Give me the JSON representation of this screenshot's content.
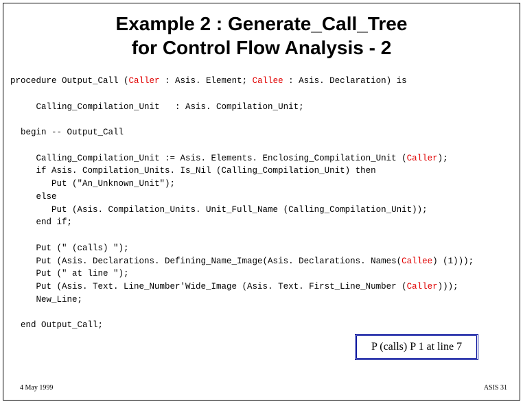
{
  "title_l1": "Example 2 : Generate_Call_Tree",
  "title_l2": "for Control Flow Analysis - 2",
  "code": {
    "l1a": "procedure Output_Call (",
    "l1b": "Caller",
    "l1c": " : Asis. Element; ",
    "l1d": "Callee",
    "l1e": " : Asis. Declaration) is",
    "l2": "     Calling_Compilation_Unit   : Asis. Compilation_Unit;",
    "l3": "  begin -- Output_Call",
    "l4a": "     Calling_Compilation_Unit := Asis. Elements. Enclosing_Compilation_Unit (",
    "l4b": "Caller",
    "l4c": ");",
    "l5": "     if Asis. Compilation_Units. Is_Nil (Calling_Compilation_Unit) then",
    "l6": "        Put (\"An_Unknown_Unit\");",
    "l7": "     else",
    "l8": "        Put (Asis. Compilation_Units. Unit_Full_Name (Calling_Compilation_Unit));",
    "l9": "     end if;",
    "l10": "     Put (\" (calls) \");",
    "l11a": "     Put (Asis. Declarations. Defining_Name_Image(Asis. Declarations. Names(",
    "l11b": "Callee",
    "l11c": ") (1)));",
    "l12": "     Put (\" at line \");",
    "l13a": "     Put (Asis. Text. Line_Number'Wide_Image (Asis. Text. First_Line_Number (",
    "l13b": "Caller",
    "l13c": ")));",
    "l14": "     New_Line;",
    "l15": "  end Output_Call;"
  },
  "callout": "P (calls) P 1 at line 7",
  "footer_left": "4 May 1999",
  "footer_right": "ASIS 31"
}
